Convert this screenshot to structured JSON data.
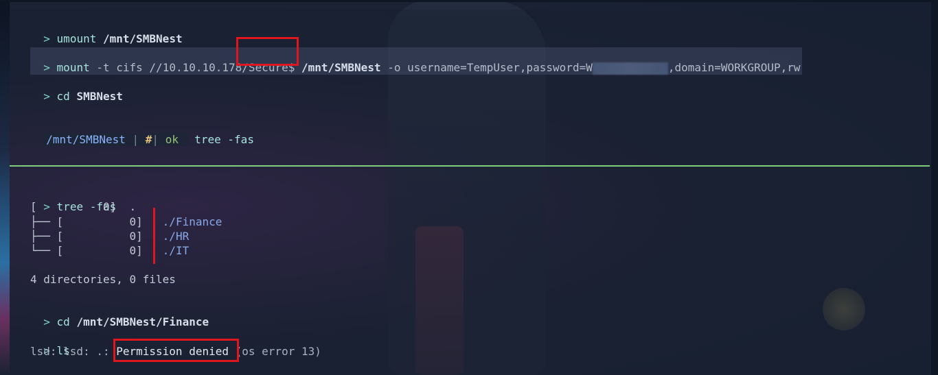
{
  "prompt_symbol": ">",
  "line1": {
    "cmd": "umount",
    "arg": "/mnt/SMBNest"
  },
  "line2": {
    "cmd": "mount",
    "part1": "-t cifs //10.10.10.178",
    "share": "/Secure$",
    "target": "/mnt/SMBNest",
    "opts_prefix": "-o username=TempUser,password=",
    "opts_redacted_start": "W",
    "opts_suffix": ",domain=WORKGROUP,rw"
  },
  "line3": {
    "cmd": "cd",
    "arg": "SMBNest"
  },
  "powerline": {
    "path": "/mnt/SMBNest",
    "sep": "|",
    "hash": "#",
    "status": "ok",
    "typed": "tree -fas"
  },
  "tree_section": {
    "cmd": "tree -fas",
    "root": "[          0]  .",
    "entries": [
      {
        "prefix": "├── [          0]",
        "name": "./Finance"
      },
      {
        "prefix": "├── [          0]",
        "name": "./HR"
      },
      {
        "prefix": "└── [          0]",
        "name": "./IT"
      }
    ],
    "summary": "4 directories, 0 files"
  },
  "line_cd_finance": {
    "cmd": "cd",
    "arg": "/mnt/SMBNest/Finance"
  },
  "line_ls": {
    "cmd": "ls"
  },
  "error": {
    "prefix": "lsd: lsd: .: ",
    "highlight": "Permission denied",
    "suffix": " (os error 13)"
  },
  "colors": {
    "highlight_box": "#e0161e",
    "divider": "#7fd07a",
    "prompt": "#7fd4c8"
  }
}
